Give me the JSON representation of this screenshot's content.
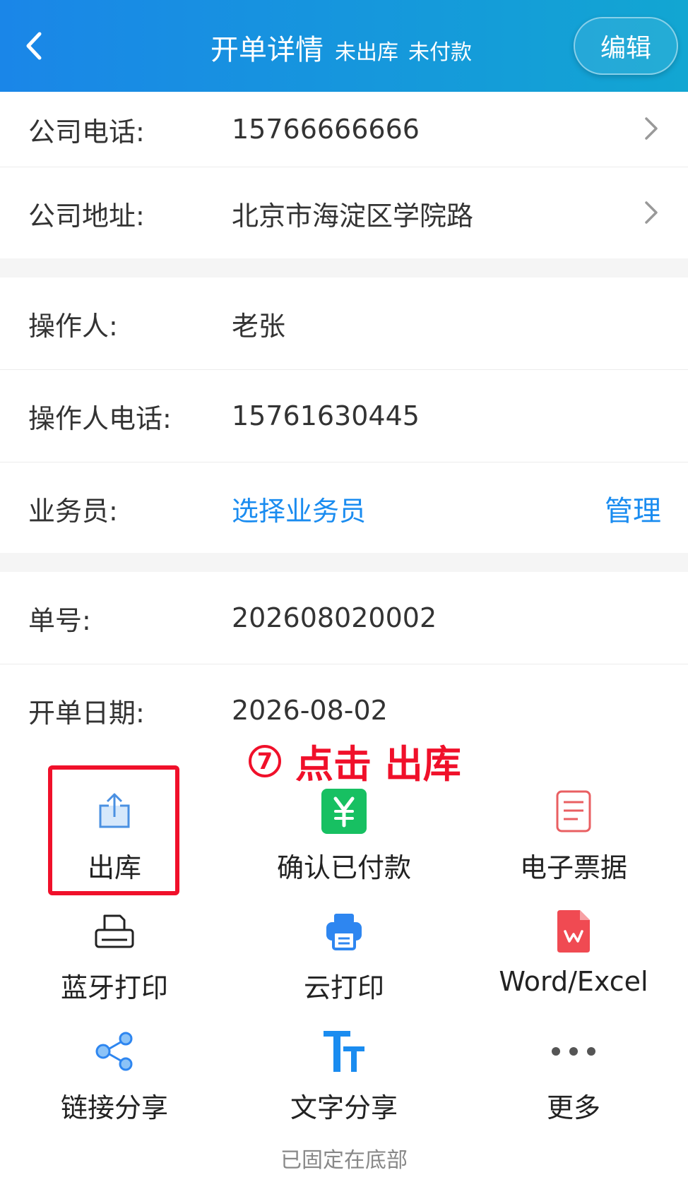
{
  "header": {
    "title": "开单详情",
    "status_stock": "未出库",
    "status_payment": "未付款",
    "edit_label": "编辑"
  },
  "company": {
    "phone_label": "公司电话:",
    "phone_value": "15766666666",
    "address_label": "公司地址:",
    "address_value": "北京市海淀区学院路"
  },
  "operator": {
    "name_label": "操作人:",
    "name_value": "老张",
    "phone_label": "操作人电话:",
    "phone_value": "15761630445",
    "salesman_label": "业务员:",
    "salesman_value": "选择业务员",
    "manage_label": "管理"
  },
  "order": {
    "number_label": "单号:",
    "number_value": "202608020002",
    "date_label": "开单日期:",
    "date_value": "2026-08-02"
  },
  "actions": [
    {
      "label": "出库",
      "icon": "stock-out-icon"
    },
    {
      "label": "确认已付款",
      "icon": "yuan-icon"
    },
    {
      "label": "电子票据",
      "icon": "document-icon"
    },
    {
      "label": "蓝牙打印",
      "icon": "printer-icon"
    },
    {
      "label": "云打印",
      "icon": "cloud-print-icon"
    },
    {
      "label": "Word/Excel",
      "icon": "word-icon"
    },
    {
      "label": "链接分享",
      "icon": "share-icon"
    },
    {
      "label": "文字分享",
      "icon": "text-icon"
    },
    {
      "label": "更多",
      "icon": "more-icon"
    }
  ],
  "footer_note": "已固定在底部",
  "annotation": {
    "step": "7",
    "text": "点击 出库"
  },
  "colors": {
    "header_start": "#1a86e8",
    "header_end": "#12a6d2",
    "link": "#1a8cf0",
    "annotation": "#f0102a",
    "pay_green": "#17c062",
    "word_red": "#f04a52"
  }
}
